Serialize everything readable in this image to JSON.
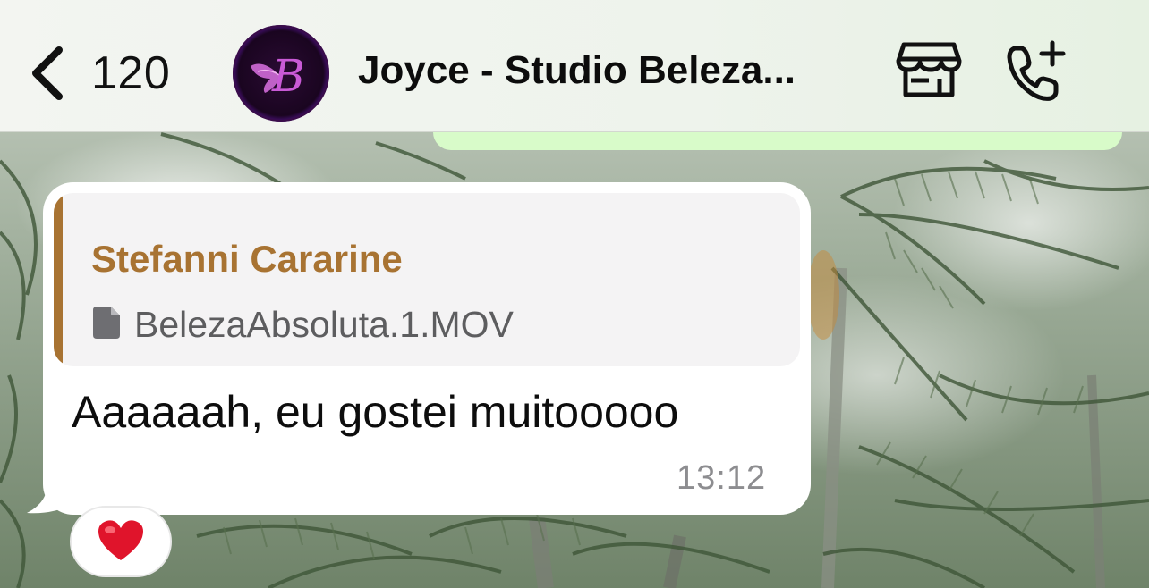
{
  "header": {
    "back_count": "120",
    "contact_name": "Joyce - Studio Beleza...",
    "avatar_letter": "B"
  },
  "message": {
    "quote_author": "Stefanni Cararine",
    "quote_file_name": "BelezaAbsoluta.1.MOV",
    "text": "Aaaaaah, eu gostei muitooooo",
    "time": "13:12",
    "reaction": "heart"
  },
  "colors": {
    "quote_accent": "#a87332",
    "outgoing_bubble": "#d8fbc9",
    "reaction_heart": "#e0142b"
  },
  "icons": {
    "back": "chevron-left-icon",
    "store": "store-icon",
    "call": "add-call-icon",
    "file": "document-icon",
    "reaction": "heart-icon"
  }
}
